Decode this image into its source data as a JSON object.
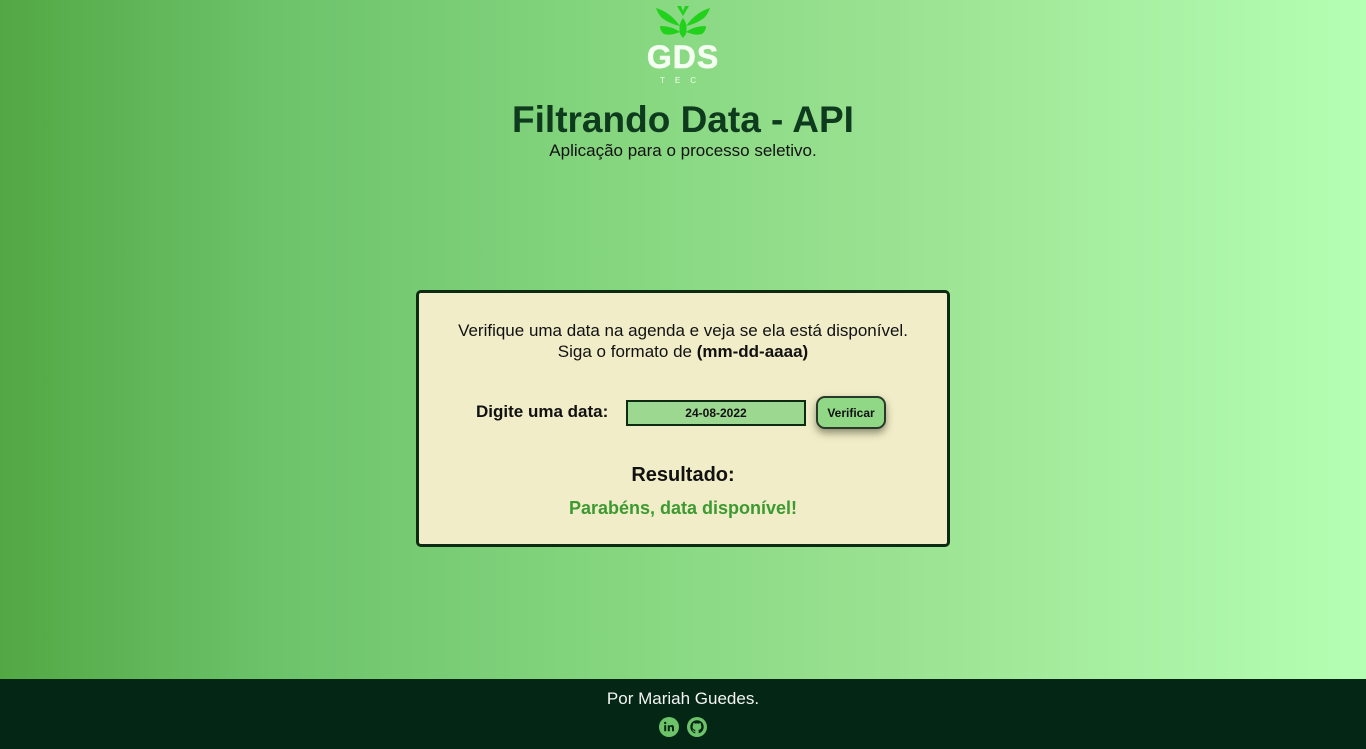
{
  "header": {
    "logo_text": "GDS",
    "logo_subtext": "TEC",
    "title": "Filtrando Data - API",
    "subtitle": "Aplicação para o processo seletivo."
  },
  "card": {
    "instruction_line1": "Verifique uma data na agenda e veja se ela está disponível.",
    "instruction_line2_prefix": "Siga o formato de ",
    "instruction_format": "(mm-dd-aaaa)",
    "date_label": "Digite uma data:",
    "date_value": "24-08-2022",
    "verify_button": "Verificar",
    "result_title": "Resultado:",
    "result_text": "Parabéns, data disponível!"
  },
  "footer": {
    "credit": "Por Mariah Guedes.",
    "icons": [
      "linkedin-icon",
      "github-icon"
    ]
  },
  "colors": {
    "background_start": "#53a844",
    "background_end": "#b4ffb3",
    "title": "#0e3a1d",
    "card_background": "#f1edc8",
    "input_background": "#9dd891",
    "button_background": "#90d886",
    "result_success": "#3c9a31",
    "footer_background": "#032714",
    "icon_color": "#6cc36a"
  }
}
